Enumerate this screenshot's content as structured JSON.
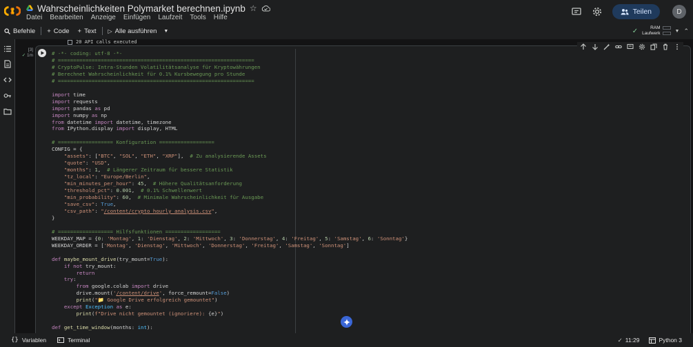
{
  "header": {
    "title": "Wahrscheinlichkeiten Polymarket berechnen.ipynb",
    "menu": [
      "Datei",
      "Bearbeiten",
      "Anzeige",
      "Einfügen",
      "Laufzeit",
      "Tools",
      "Hilfe"
    ],
    "share_label": "Teilen",
    "avatar_letter": "D"
  },
  "toolbar": {
    "commands_label": "Befehle",
    "code_label": "Code",
    "text_label": "Text",
    "run_all_label": "Alle ausführen",
    "ram_label": "RAM",
    "disk_label": "Laufwerk"
  },
  "prev_output": "20 API calls executed",
  "cell": {
    "exec_count": "[3]",
    "duration": "1m"
  },
  "code_lines": [
    [
      [
        "c-cm",
        "# -*- coding: utf-8 -*-"
      ]
    ],
    [
      [
        "c-cm",
        "# ================================================================"
      ]
    ],
    [
      [
        "c-cm",
        "# CryptoPulse: Intra-Stunden Volatilitätsanalyse für Kryptowährungen"
      ]
    ],
    [
      [
        "c-cm",
        "# Berechnet Wahrscheinlichkeit für 0.1% Kursbewegung pro Stunde"
      ]
    ],
    [
      [
        "c-cm",
        "# ================================================================"
      ]
    ],
    [],
    [
      [
        "c-kw",
        "import"
      ],
      [
        "c-tx",
        " time"
      ]
    ],
    [
      [
        "c-kw",
        "import"
      ],
      [
        "c-tx",
        " requests"
      ]
    ],
    [
      [
        "c-kw",
        "import"
      ],
      [
        "c-tx",
        " pandas "
      ],
      [
        "c-kw",
        "as"
      ],
      [
        "c-tx",
        " pd"
      ]
    ],
    [
      [
        "c-kw",
        "import"
      ],
      [
        "c-tx",
        " numpy "
      ],
      [
        "c-kw",
        "as"
      ],
      [
        "c-tx",
        " np"
      ]
    ],
    [
      [
        "c-kw",
        "from"
      ],
      [
        "c-tx",
        " datetime "
      ],
      [
        "c-kw",
        "import"
      ],
      [
        "c-tx",
        " datetime, timezone"
      ]
    ],
    [
      [
        "c-kw",
        "from"
      ],
      [
        "c-tx",
        " IPython.display "
      ],
      [
        "c-kw",
        "import"
      ],
      [
        "c-tx",
        " display, HTML"
      ]
    ],
    [],
    [
      [
        "c-cm",
        "# ================== Konfiguration =================="
      ]
    ],
    [
      [
        "c-tx",
        "CONFIG = {"
      ]
    ],
    [
      [
        "c-tx",
        "    "
      ],
      [
        "c-st",
        "\"assets\""
      ],
      [
        "c-tx",
        ": ["
      ],
      [
        "c-st",
        "\"BTC\""
      ],
      [
        "c-tx",
        ", "
      ],
      [
        "c-st",
        "\"SOL\""
      ],
      [
        "c-tx",
        ", "
      ],
      [
        "c-st",
        "\"ETH\""
      ],
      [
        "c-tx",
        ", "
      ],
      [
        "c-st",
        "\"XRP\""
      ],
      [
        "c-tx",
        "],  "
      ],
      [
        "c-cm",
        "# Zu analysierende Assets"
      ]
    ],
    [
      [
        "c-tx",
        "    "
      ],
      [
        "c-st",
        "\"quote\""
      ],
      [
        "c-tx",
        ": "
      ],
      [
        "c-st",
        "\"USD\""
      ],
      [
        "c-tx",
        ","
      ]
    ],
    [
      [
        "c-tx",
        "    "
      ],
      [
        "c-st",
        "\"months\""
      ],
      [
        "c-tx",
        ": "
      ],
      [
        "c-nu",
        "1"
      ],
      [
        "c-tx",
        ",  "
      ],
      [
        "c-cm",
        "# Längerer Zeitraum für bessere Statistik"
      ]
    ],
    [
      [
        "c-tx",
        "    "
      ],
      [
        "c-st",
        "\"tz_local\""
      ],
      [
        "c-tx",
        ": "
      ],
      [
        "c-st",
        "\"Europe/Berlin\""
      ],
      [
        "c-tx",
        ","
      ]
    ],
    [
      [
        "c-tx",
        "    "
      ],
      [
        "c-st",
        "\"min_minutes_per_hour\""
      ],
      [
        "c-tx",
        ": "
      ],
      [
        "c-nu",
        "45"
      ],
      [
        "c-tx",
        ",  "
      ],
      [
        "c-cm",
        "# Höhere Qualitätsanforderung"
      ]
    ],
    [
      [
        "c-tx",
        "    "
      ],
      [
        "c-st",
        "\"threshold_pct\""
      ],
      [
        "c-tx",
        ": "
      ],
      [
        "c-nu",
        "0.001"
      ],
      [
        "c-tx",
        ",  "
      ],
      [
        "c-cm",
        "# 0.1% Schwellenwert"
      ]
    ],
    [
      [
        "c-tx",
        "    "
      ],
      [
        "c-st",
        "\"min_probability\""
      ],
      [
        "c-tx",
        ": "
      ],
      [
        "c-nu",
        "60"
      ],
      [
        "c-tx",
        ",  "
      ],
      [
        "c-cm",
        "# Minimale Wahrscheinlichkeit für Ausgabe"
      ]
    ],
    [
      [
        "c-tx",
        "    "
      ],
      [
        "c-st",
        "\"save_csv\""
      ],
      [
        "c-tx",
        ": "
      ],
      [
        "c-cl",
        "True"
      ],
      [
        "c-tx",
        ","
      ]
    ],
    [
      [
        "c-tx",
        "    "
      ],
      [
        "c-st",
        "\"csv_path\""
      ],
      [
        "c-tx",
        ": "
      ],
      [
        "c-st",
        "\""
      ],
      [
        "c-ln",
        "/content/crypto_hourly_analysis.csv"
      ],
      [
        "c-st",
        "\""
      ],
      [
        "c-tx",
        ","
      ]
    ],
    [
      [
        "c-tx",
        "}"
      ]
    ],
    [],
    [
      [
        "c-cm",
        "# ================== Hilfsfunktionen =================="
      ]
    ],
    [
      [
        "c-tx",
        "WEEKDAY_MAP = {"
      ],
      [
        "c-nu",
        "0"
      ],
      [
        "c-tx",
        ": "
      ],
      [
        "c-st",
        "'Montag'"
      ],
      [
        "c-tx",
        ", "
      ],
      [
        "c-nu",
        "1"
      ],
      [
        "c-tx",
        ": "
      ],
      [
        "c-st",
        "'Dienstag'"
      ],
      [
        "c-tx",
        ", "
      ],
      [
        "c-nu",
        "2"
      ],
      [
        "c-tx",
        ": "
      ],
      [
        "c-st",
        "'Mittwoch'"
      ],
      [
        "c-tx",
        ", "
      ],
      [
        "c-nu",
        "3"
      ],
      [
        "c-tx",
        ": "
      ],
      [
        "c-st",
        "'Donnerstag'"
      ],
      [
        "c-tx",
        ", "
      ],
      [
        "c-nu",
        "4"
      ],
      [
        "c-tx",
        ": "
      ],
      [
        "c-st",
        "'Freitag'"
      ],
      [
        "c-tx",
        ", "
      ],
      [
        "c-nu",
        "5"
      ],
      [
        "c-tx",
        ": "
      ],
      [
        "c-st",
        "'Samstag'"
      ],
      [
        "c-tx",
        ", "
      ],
      [
        "c-nu",
        "6"
      ],
      [
        "c-tx",
        ": "
      ],
      [
        "c-st",
        "'Sonntag'"
      ],
      [
        "c-tx",
        "}"
      ]
    ],
    [
      [
        "c-tx",
        "WEEKDAY_ORDER = ["
      ],
      [
        "c-st",
        "'Montag'"
      ],
      [
        "c-tx",
        ", "
      ],
      [
        "c-st",
        "'Dienstag'"
      ],
      [
        "c-tx",
        ", "
      ],
      [
        "c-st",
        "'Mittwoch'"
      ],
      [
        "c-tx",
        ", "
      ],
      [
        "c-st",
        "'Donnerstag'"
      ],
      [
        "c-tx",
        ", "
      ],
      [
        "c-st",
        "'Freitag'"
      ],
      [
        "c-tx",
        ", "
      ],
      [
        "c-st",
        "'Samstag'"
      ],
      [
        "c-tx",
        ", "
      ],
      [
        "c-st",
        "'Sonntag'"
      ],
      [
        "c-tx",
        "]"
      ]
    ],
    [],
    [
      [
        "c-kw",
        "def"
      ],
      [
        "c-tx",
        " "
      ],
      [
        "c-fn",
        "maybe_mount_drive"
      ],
      [
        "c-tx",
        "(try_mount="
      ],
      [
        "c-cl",
        "True"
      ],
      [
        "c-tx",
        "):"
      ]
    ],
    [
      [
        "c-tx",
        "    "
      ],
      [
        "c-kw",
        "if not"
      ],
      [
        "c-tx",
        " try_mount:"
      ]
    ],
    [
      [
        "c-tx",
        "        "
      ],
      [
        "c-kw",
        "return"
      ]
    ],
    [
      [
        "c-tx",
        "    "
      ],
      [
        "c-kw",
        "try"
      ],
      [
        "c-tx",
        ":"
      ]
    ],
    [
      [
        "c-tx",
        "        "
      ],
      [
        "c-kw",
        "from"
      ],
      [
        "c-tx",
        " google.colab "
      ],
      [
        "c-kw",
        "import"
      ],
      [
        "c-tx",
        " drive"
      ]
    ],
    [
      [
        "c-tx",
        "        drive.mount("
      ],
      [
        "c-st",
        "'"
      ],
      [
        "c-ln",
        "/content/drive"
      ],
      [
        "c-st",
        "'"
      ],
      [
        "c-tx",
        ", force_remount="
      ],
      [
        "c-cl",
        "False"
      ],
      [
        "c-tx",
        ")"
      ]
    ],
    [
      [
        "c-tx",
        "        "
      ],
      [
        "c-fn",
        "print"
      ],
      [
        "c-tx",
        "("
      ],
      [
        "c-st",
        "\"📁 Google Drive erfolgreich gemountet\""
      ],
      [
        "c-tx",
        ")"
      ]
    ],
    [
      [
        "c-tx",
        "    "
      ],
      [
        "c-kw",
        "except"
      ],
      [
        "c-tx",
        " "
      ],
      [
        "c-bi",
        "Exception"
      ],
      [
        "c-tx",
        " "
      ],
      [
        "c-kw",
        "as"
      ],
      [
        "c-tx",
        " e:"
      ]
    ],
    [
      [
        "c-tx",
        "        "
      ],
      [
        "c-fn",
        "print"
      ],
      [
        "c-tx",
        "("
      ],
      [
        "c-st",
        "f\"Drive nicht gemountet (ignoriere): "
      ],
      [
        "c-tx",
        "{e}"
      ],
      [
        "c-st",
        "\""
      ],
      [
        "c-tx",
        ")"
      ]
    ],
    [],
    [
      [
        "c-kw",
        "def"
      ],
      [
        "c-tx",
        " "
      ],
      [
        "c-fn",
        "get_time_window"
      ],
      [
        "c-tx",
        "(months: "
      ],
      [
        "c-bi",
        "int"
      ],
      [
        "c-tx",
        "):"
      ]
    ]
  ],
  "status": {
    "variables_label": "Variablen",
    "terminal_label": "Terminal",
    "time": "11:29",
    "kernel": "Python 3"
  }
}
